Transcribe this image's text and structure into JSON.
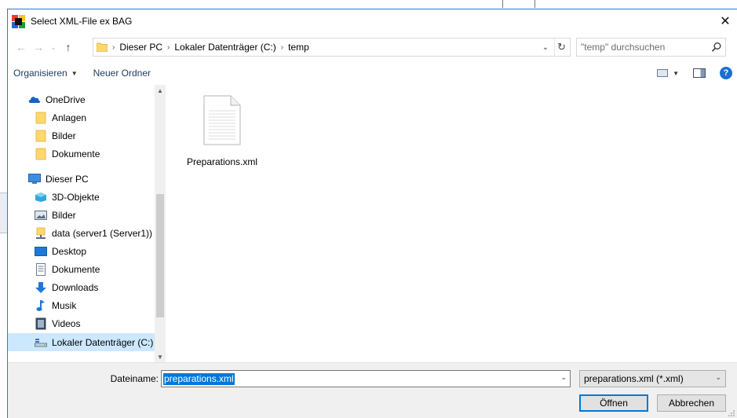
{
  "dialog": {
    "title": "Select XML-File ex BAG",
    "close_symbol": "✕"
  },
  "nav": {
    "back_symbol": "←",
    "forward_symbol": "→",
    "recent_symbol": "⌄",
    "up_symbol": "↑",
    "breadcrumbs": [
      "Dieser PC",
      "Lokaler Datenträger (C:)",
      "temp"
    ],
    "crumb_sep": "›",
    "dropdown_symbol": "⌄",
    "refresh_symbol": "↻",
    "search_placeholder": "\"temp\" durchsuchen"
  },
  "toolbar": {
    "organize_label": "Organisieren",
    "organize_caret": "▼",
    "new_folder_label": "Neuer Ordner",
    "view_caret": "▼",
    "help_symbol": "?"
  },
  "sidebar": {
    "items": [
      {
        "label": "OneDrive",
        "icon": "onedrive-icon"
      },
      {
        "label": "Anlagen",
        "icon": "folder-icon"
      },
      {
        "label": "Bilder",
        "icon": "folder-icon"
      },
      {
        "label": "Dokumente",
        "icon": "folder-icon"
      },
      {
        "label": "Dieser PC",
        "icon": "pc-icon"
      },
      {
        "label": "3D-Objekte",
        "icon": "3d-objects-icon"
      },
      {
        "label": "Bilder",
        "icon": "pictures-icon"
      },
      {
        "label": "data (server1 (Server1))",
        "icon": "network-drive-icon"
      },
      {
        "label": "Desktop",
        "icon": "desktop-icon"
      },
      {
        "label": "Dokumente",
        "icon": "documents-icon"
      },
      {
        "label": "Downloads",
        "icon": "downloads-icon"
      },
      {
        "label": "Musik",
        "icon": "music-icon"
      },
      {
        "label": "Videos",
        "icon": "videos-icon"
      },
      {
        "label": "Lokaler Datenträger (C:)",
        "icon": "local-disk-icon",
        "selected": true
      }
    ],
    "scroll_up_symbol": "▲",
    "scroll_down_symbol": "▼"
  },
  "content": {
    "files": [
      {
        "name": "Preparations.xml",
        "icon": "xml-file-icon"
      }
    ]
  },
  "bottom": {
    "filename_label": "Dateiname:",
    "filename_value": "preparations.xml",
    "filename_dropdown": "⌄",
    "filter_value": "preparations.xml (*.xml)",
    "filter_dropdown": "⌄",
    "open_label": "Öffnen",
    "cancel_label": "Abbrechen"
  },
  "colors": {
    "accent": "#0078d7",
    "selection": "#cce8ff",
    "folder": "#ffd86b",
    "border": "#2b79d0"
  }
}
